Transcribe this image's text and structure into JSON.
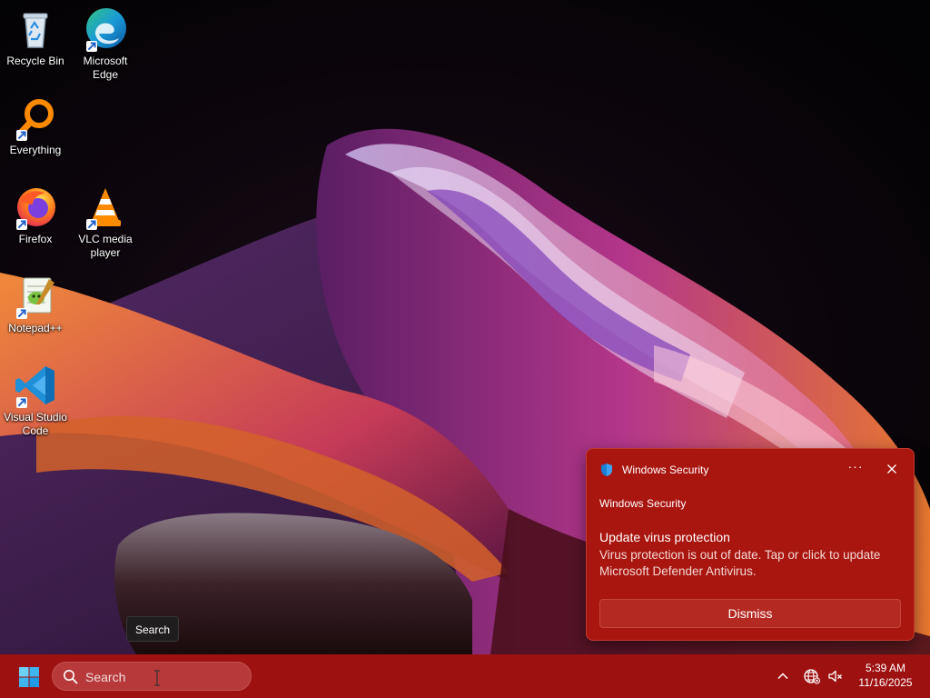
{
  "desktop": {
    "icons": [
      {
        "label": "Recycle Bin",
        "icon": "recycle-bin-icon"
      },
      {
        "label": "Microsoft Edge",
        "icon": "edge-icon"
      },
      {
        "label": "Everything",
        "icon": "everything-search-icon"
      },
      {
        "label": "Firefox",
        "icon": "firefox-icon"
      },
      {
        "label": "VLC media player",
        "icon": "vlc-icon"
      },
      {
        "label": "Notepad++",
        "icon": "notepadpp-icon"
      },
      {
        "label": "Visual Studio Code",
        "icon": "vscode-icon"
      }
    ]
  },
  "tooltip": {
    "text": "Search"
  },
  "notification": {
    "app_name": "Windows Security",
    "more_label": "···",
    "attribution": "Windows Security",
    "title": "Update virus protection",
    "body": "Virus protection is out of date. Tap or click to update Microsoft Defender Antivirus.",
    "dismiss_label": "Dismiss"
  },
  "taskbar": {
    "search_placeholder": "Search",
    "time": "5:39 AM",
    "date": "11/16/2025"
  },
  "colors": {
    "taskbar": "#9e1111",
    "toast": "#a9150f",
    "accent_blue": "#1b7fd6"
  }
}
